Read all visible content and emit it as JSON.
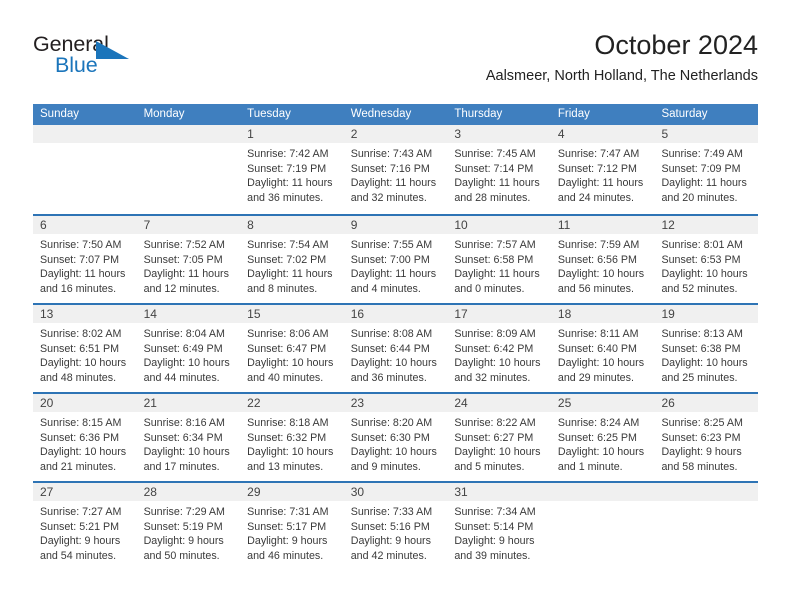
{
  "brand": {
    "name_part1": "General",
    "name_part2": "Blue",
    "triangle_color": "#1b75bb"
  },
  "header": {
    "title": "October 2024",
    "subtitle": "Aalsmeer, North Holland, The Netherlands"
  },
  "theme": {
    "header_blue": "#3f7fbf",
    "row_border_blue": "#2e74b5",
    "daynum_band": "#f0f0f0",
    "text": "#3a3a3a"
  },
  "weekdays": [
    "Sunday",
    "Monday",
    "Tuesday",
    "Wednesday",
    "Thursday",
    "Friday",
    "Saturday"
  ],
  "weeks": [
    [
      {
        "day": "",
        "sunrise": "",
        "sunset": "",
        "daylight1": "",
        "daylight2": ""
      },
      {
        "day": "",
        "sunrise": "",
        "sunset": "",
        "daylight1": "",
        "daylight2": ""
      },
      {
        "day": "1",
        "sunrise": "Sunrise: 7:42 AM",
        "sunset": "Sunset: 7:19 PM",
        "daylight1": "Daylight: 11 hours",
        "daylight2": "and 36 minutes."
      },
      {
        "day": "2",
        "sunrise": "Sunrise: 7:43 AM",
        "sunset": "Sunset: 7:16 PM",
        "daylight1": "Daylight: 11 hours",
        "daylight2": "and 32 minutes."
      },
      {
        "day": "3",
        "sunrise": "Sunrise: 7:45 AM",
        "sunset": "Sunset: 7:14 PM",
        "daylight1": "Daylight: 11 hours",
        "daylight2": "and 28 minutes."
      },
      {
        "day": "4",
        "sunrise": "Sunrise: 7:47 AM",
        "sunset": "Sunset: 7:12 PM",
        "daylight1": "Daylight: 11 hours",
        "daylight2": "and 24 minutes."
      },
      {
        "day": "5",
        "sunrise": "Sunrise: 7:49 AM",
        "sunset": "Sunset: 7:09 PM",
        "daylight1": "Daylight: 11 hours",
        "daylight2": "and 20 minutes."
      }
    ],
    [
      {
        "day": "6",
        "sunrise": "Sunrise: 7:50 AM",
        "sunset": "Sunset: 7:07 PM",
        "daylight1": "Daylight: 11 hours",
        "daylight2": "and 16 minutes."
      },
      {
        "day": "7",
        "sunrise": "Sunrise: 7:52 AM",
        "sunset": "Sunset: 7:05 PM",
        "daylight1": "Daylight: 11 hours",
        "daylight2": "and 12 minutes."
      },
      {
        "day": "8",
        "sunrise": "Sunrise: 7:54 AM",
        "sunset": "Sunset: 7:02 PM",
        "daylight1": "Daylight: 11 hours",
        "daylight2": "and 8 minutes."
      },
      {
        "day": "9",
        "sunrise": "Sunrise: 7:55 AM",
        "sunset": "Sunset: 7:00 PM",
        "daylight1": "Daylight: 11 hours",
        "daylight2": "and 4 minutes."
      },
      {
        "day": "10",
        "sunrise": "Sunrise: 7:57 AM",
        "sunset": "Sunset: 6:58 PM",
        "daylight1": "Daylight: 11 hours",
        "daylight2": "and 0 minutes."
      },
      {
        "day": "11",
        "sunrise": "Sunrise: 7:59 AM",
        "sunset": "Sunset: 6:56 PM",
        "daylight1": "Daylight: 10 hours",
        "daylight2": "and 56 minutes."
      },
      {
        "day": "12",
        "sunrise": "Sunrise: 8:01 AM",
        "sunset": "Sunset: 6:53 PM",
        "daylight1": "Daylight: 10 hours",
        "daylight2": "and 52 minutes."
      }
    ],
    [
      {
        "day": "13",
        "sunrise": "Sunrise: 8:02 AM",
        "sunset": "Sunset: 6:51 PM",
        "daylight1": "Daylight: 10 hours",
        "daylight2": "and 48 minutes."
      },
      {
        "day": "14",
        "sunrise": "Sunrise: 8:04 AM",
        "sunset": "Sunset: 6:49 PM",
        "daylight1": "Daylight: 10 hours",
        "daylight2": "and 44 minutes."
      },
      {
        "day": "15",
        "sunrise": "Sunrise: 8:06 AM",
        "sunset": "Sunset: 6:47 PM",
        "daylight1": "Daylight: 10 hours",
        "daylight2": "and 40 minutes."
      },
      {
        "day": "16",
        "sunrise": "Sunrise: 8:08 AM",
        "sunset": "Sunset: 6:44 PM",
        "daylight1": "Daylight: 10 hours",
        "daylight2": "and 36 minutes."
      },
      {
        "day": "17",
        "sunrise": "Sunrise: 8:09 AM",
        "sunset": "Sunset: 6:42 PM",
        "daylight1": "Daylight: 10 hours",
        "daylight2": "and 32 minutes."
      },
      {
        "day": "18",
        "sunrise": "Sunrise: 8:11 AM",
        "sunset": "Sunset: 6:40 PM",
        "daylight1": "Daylight: 10 hours",
        "daylight2": "and 29 minutes."
      },
      {
        "day": "19",
        "sunrise": "Sunrise: 8:13 AM",
        "sunset": "Sunset: 6:38 PM",
        "daylight1": "Daylight: 10 hours",
        "daylight2": "and 25 minutes."
      }
    ],
    [
      {
        "day": "20",
        "sunrise": "Sunrise: 8:15 AM",
        "sunset": "Sunset: 6:36 PM",
        "daylight1": "Daylight: 10 hours",
        "daylight2": "and 21 minutes."
      },
      {
        "day": "21",
        "sunrise": "Sunrise: 8:16 AM",
        "sunset": "Sunset: 6:34 PM",
        "daylight1": "Daylight: 10 hours",
        "daylight2": "and 17 minutes."
      },
      {
        "day": "22",
        "sunrise": "Sunrise: 8:18 AM",
        "sunset": "Sunset: 6:32 PM",
        "daylight1": "Daylight: 10 hours",
        "daylight2": "and 13 minutes."
      },
      {
        "day": "23",
        "sunrise": "Sunrise: 8:20 AM",
        "sunset": "Sunset: 6:30 PM",
        "daylight1": "Daylight: 10 hours",
        "daylight2": "and 9 minutes."
      },
      {
        "day": "24",
        "sunrise": "Sunrise: 8:22 AM",
        "sunset": "Sunset: 6:27 PM",
        "daylight1": "Daylight: 10 hours",
        "daylight2": "and 5 minutes."
      },
      {
        "day": "25",
        "sunrise": "Sunrise: 8:24 AM",
        "sunset": "Sunset: 6:25 PM",
        "daylight1": "Daylight: 10 hours",
        "daylight2": "and 1 minute."
      },
      {
        "day": "26",
        "sunrise": "Sunrise: 8:25 AM",
        "sunset": "Sunset: 6:23 PM",
        "daylight1": "Daylight: 9 hours",
        "daylight2": "and 58 minutes."
      }
    ],
    [
      {
        "day": "27",
        "sunrise": "Sunrise: 7:27 AM",
        "sunset": "Sunset: 5:21 PM",
        "daylight1": "Daylight: 9 hours",
        "daylight2": "and 54 minutes."
      },
      {
        "day": "28",
        "sunrise": "Sunrise: 7:29 AM",
        "sunset": "Sunset: 5:19 PM",
        "daylight1": "Daylight: 9 hours",
        "daylight2": "and 50 minutes."
      },
      {
        "day": "29",
        "sunrise": "Sunrise: 7:31 AM",
        "sunset": "Sunset: 5:17 PM",
        "daylight1": "Daylight: 9 hours",
        "daylight2": "and 46 minutes."
      },
      {
        "day": "30",
        "sunrise": "Sunrise: 7:33 AM",
        "sunset": "Sunset: 5:16 PM",
        "daylight1": "Daylight: 9 hours",
        "daylight2": "and 42 minutes."
      },
      {
        "day": "31",
        "sunrise": "Sunrise: 7:34 AM",
        "sunset": "Sunset: 5:14 PM",
        "daylight1": "Daylight: 9 hours",
        "daylight2": "and 39 minutes."
      },
      {
        "day": "",
        "sunrise": "",
        "sunset": "",
        "daylight1": "",
        "daylight2": ""
      },
      {
        "day": "",
        "sunrise": "",
        "sunset": "",
        "daylight1": "",
        "daylight2": ""
      }
    ]
  ]
}
